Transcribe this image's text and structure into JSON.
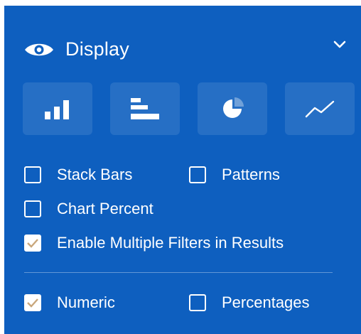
{
  "panel": {
    "title": "Display",
    "icons": {
      "header": "eye-icon",
      "toggle": "chevron-down-icon"
    }
  },
  "chart_types": [
    {
      "name": "column-chart",
      "icon": "column-chart-icon"
    },
    {
      "name": "bar-chart",
      "icon": "bar-chart-icon"
    },
    {
      "name": "pie-chart",
      "icon": "pie-chart-icon"
    },
    {
      "name": "line-chart",
      "icon": "line-chart-icon"
    }
  ],
  "options": {
    "stack_bars": {
      "label": "Stack Bars",
      "checked": false
    },
    "patterns": {
      "label": "Patterns",
      "checked": false
    },
    "chart_percent": {
      "label": "Chart Percent",
      "checked": false
    },
    "enable_multiple_filters": {
      "label": "Enable Multiple Filters in Results",
      "checked": true
    },
    "numeric": {
      "label": "Numeric",
      "checked": true
    },
    "percentages": {
      "label": "Percentages",
      "checked": false
    }
  },
  "colors": {
    "panel_background": "#0e5fbf",
    "check_mark": "#c9a77c"
  }
}
